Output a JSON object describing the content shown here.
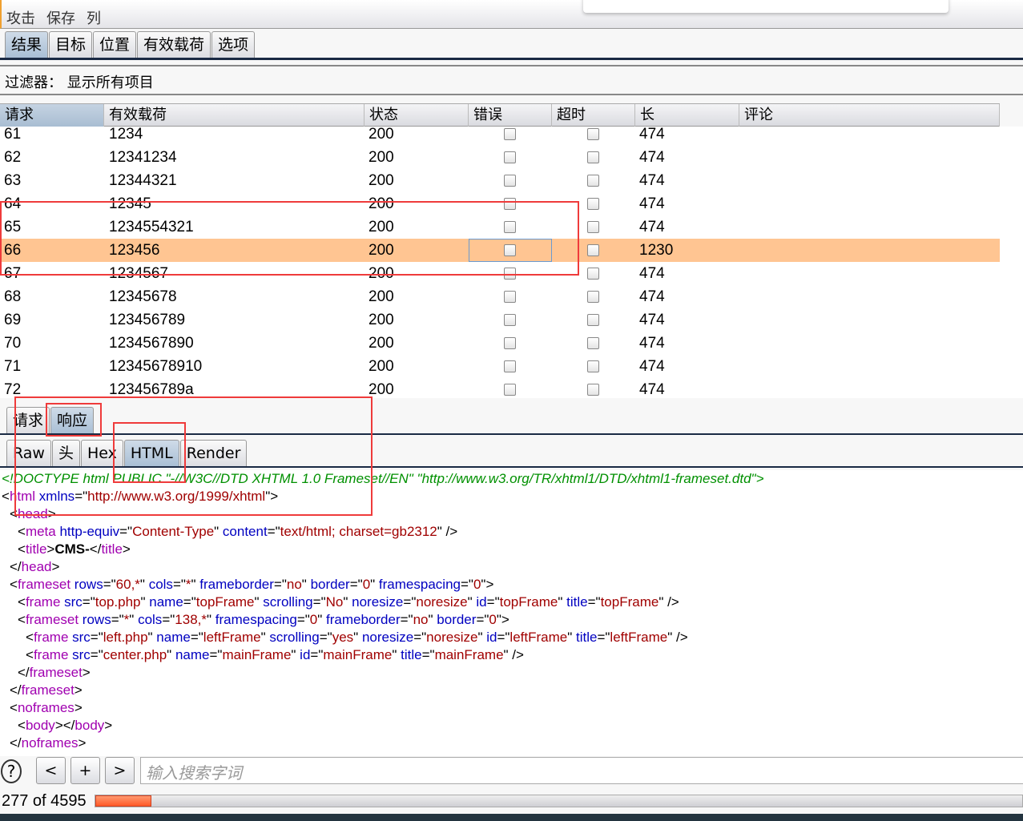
{
  "menu": [
    "攻击",
    "保存",
    "列"
  ],
  "main_tabs": [
    {
      "label": "结果",
      "selected": true
    },
    {
      "label": "目标"
    },
    {
      "label": "位置"
    },
    {
      "label": "有效载荷"
    },
    {
      "label": "选项"
    }
  ],
  "filter": "过滤器： 显示所有项目",
  "table": {
    "columns": [
      "请求",
      "有效载荷",
      "状态",
      "错误",
      "超时",
      "长",
      "评论"
    ],
    "sorted_column": "请求",
    "rows": [
      {
        "req": "61",
        "payload": "1234",
        "status": "200",
        "error": false,
        "timeout": false,
        "length": "474"
      },
      {
        "req": "62",
        "payload": "12341234",
        "status": "200",
        "error": false,
        "timeout": false,
        "length": "474"
      },
      {
        "req": "63",
        "payload": "12344321",
        "status": "200",
        "error": false,
        "timeout": false,
        "length": "474"
      },
      {
        "req": "64",
        "payload": "12345",
        "status": "200",
        "error": false,
        "timeout": false,
        "length": "474"
      },
      {
        "req": "65",
        "payload": "1234554321",
        "status": "200",
        "error": false,
        "timeout": false,
        "length": "474"
      },
      {
        "req": "66",
        "payload": "123456",
        "status": "200",
        "error": false,
        "timeout": false,
        "length": "1230",
        "selected": true
      },
      {
        "req": "67",
        "payload": "1234567",
        "status": "200",
        "error": false,
        "timeout": false,
        "length": "474"
      },
      {
        "req": "68",
        "payload": "12345678",
        "status": "200",
        "error": false,
        "timeout": false,
        "length": "474"
      },
      {
        "req": "69",
        "payload": "123456789",
        "status": "200",
        "error": false,
        "timeout": false,
        "length": "474"
      },
      {
        "req": "70",
        "payload": "1234567890",
        "status": "200",
        "error": false,
        "timeout": false,
        "length": "474"
      },
      {
        "req": "71",
        "payload": "12345678910",
        "status": "200",
        "error": false,
        "timeout": false,
        "length": "474"
      },
      {
        "req": "72",
        "payload": "123456789a",
        "status": "200",
        "error": false,
        "timeout": false,
        "length": "474"
      }
    ]
  },
  "detail_tabs": [
    {
      "label": "请求"
    },
    {
      "label": "响应",
      "selected": true
    }
  ],
  "view_tabs": [
    {
      "label": "Raw"
    },
    {
      "label": "头"
    },
    {
      "label": "Hex"
    },
    {
      "label": "HTML",
      "selected": true
    },
    {
      "label": "Render"
    }
  ],
  "code_lines": [
    {
      "indent": 0,
      "tokens": [
        [
          "doc",
          "<!DOCTYPE html PUBLIC \"-//W3C//DTD XHTML 1.0 Frameset//EN\" \"http://www.w3.org/TR/xhtml1/DTD/xhtml1-frameset.dtd\">"
        ]
      ]
    },
    {
      "indent": 0,
      "tokens": [
        [
          "punc",
          "<"
        ],
        [
          "tag",
          "html"
        ],
        [
          "attr",
          " xmlns"
        ],
        [
          "punc",
          "=\""
        ],
        [
          "val",
          "http://www.w3.org/1999/xhtml"
        ],
        [
          "punc",
          "\">"
        ]
      ]
    },
    {
      "indent": 1,
      "tokens": [
        [
          "punc",
          "<"
        ],
        [
          "tag",
          "head"
        ],
        [
          "punc",
          ">"
        ]
      ]
    },
    {
      "indent": 2,
      "tokens": [
        [
          "punc",
          "<"
        ],
        [
          "tag",
          "meta"
        ],
        [
          "attr",
          " http-equiv"
        ],
        [
          "punc",
          "=\""
        ],
        [
          "val",
          "Content-Type"
        ],
        [
          "punc",
          "\""
        ],
        [
          "attr",
          " content"
        ],
        [
          "punc",
          "=\""
        ],
        [
          "val",
          "text/html; charset=gb2312"
        ],
        [
          "punc",
          "\" />"
        ]
      ]
    },
    {
      "indent": 2,
      "tokens": [
        [
          "punc",
          "<"
        ],
        [
          "tag",
          "title"
        ],
        [
          "punc",
          ">"
        ],
        [
          "bold",
          "CMS-"
        ],
        [
          "punc",
          "</"
        ],
        [
          "tag",
          "title"
        ],
        [
          "punc",
          ">"
        ]
      ]
    },
    {
      "indent": 1,
      "tokens": [
        [
          "punc",
          "</"
        ],
        [
          "tag",
          "head"
        ],
        [
          "punc",
          ">"
        ]
      ]
    },
    {
      "indent": 1,
      "tokens": [
        [
          "punc",
          "<"
        ],
        [
          "tag",
          "frameset"
        ],
        [
          "attr",
          " rows"
        ],
        [
          "punc",
          "=\""
        ],
        [
          "val",
          "60,*"
        ],
        [
          "punc",
          "\""
        ],
        [
          "attr",
          " cols"
        ],
        [
          "punc",
          "=\""
        ],
        [
          "val",
          "*"
        ],
        [
          "punc",
          "\""
        ],
        [
          "attr",
          " frameborder"
        ],
        [
          "punc",
          "=\""
        ],
        [
          "val",
          "no"
        ],
        [
          "punc",
          "\""
        ],
        [
          "attr",
          " border"
        ],
        [
          "punc",
          "=\""
        ],
        [
          "val",
          "0"
        ],
        [
          "punc",
          "\""
        ],
        [
          "attr",
          " framespacing"
        ],
        [
          "punc",
          "=\""
        ],
        [
          "val",
          "0"
        ],
        [
          "punc",
          "\">"
        ]
      ]
    },
    {
      "indent": 2,
      "tokens": [
        [
          "punc",
          "<"
        ],
        [
          "tag",
          "frame"
        ],
        [
          "attr",
          " src"
        ],
        [
          "punc",
          "=\""
        ],
        [
          "val",
          "top.php"
        ],
        [
          "punc",
          "\""
        ],
        [
          "attr",
          " name"
        ],
        [
          "punc",
          "=\""
        ],
        [
          "val",
          "topFrame"
        ],
        [
          "punc",
          "\""
        ],
        [
          "attr",
          " scrolling"
        ],
        [
          "punc",
          "=\""
        ],
        [
          "val",
          "No"
        ],
        [
          "punc",
          "\""
        ],
        [
          "attr",
          " noresize"
        ],
        [
          "punc",
          "=\""
        ],
        [
          "val",
          "noresize"
        ],
        [
          "punc",
          "\""
        ],
        [
          "attr",
          " id"
        ],
        [
          "punc",
          "=\""
        ],
        [
          "val",
          "topFrame"
        ],
        [
          "punc",
          "\""
        ],
        [
          "attr",
          " title"
        ],
        [
          "punc",
          "=\""
        ],
        [
          "val",
          "topFrame"
        ],
        [
          "punc",
          "\" />"
        ]
      ]
    },
    {
      "indent": 2,
      "tokens": [
        [
          "punc",
          "<"
        ],
        [
          "tag",
          "frameset"
        ],
        [
          "attr",
          " rows"
        ],
        [
          "punc",
          "=\""
        ],
        [
          "val",
          "*"
        ],
        [
          "punc",
          "\""
        ],
        [
          "attr",
          " cols"
        ],
        [
          "punc",
          "=\""
        ],
        [
          "val",
          "138,*"
        ],
        [
          "punc",
          "\""
        ],
        [
          "attr",
          " framespacing"
        ],
        [
          "punc",
          "=\""
        ],
        [
          "val",
          "0"
        ],
        [
          "punc",
          "\""
        ],
        [
          "attr",
          " frameborder"
        ],
        [
          "punc",
          "=\""
        ],
        [
          "val",
          "no"
        ],
        [
          "punc",
          "\""
        ],
        [
          "attr",
          " border"
        ],
        [
          "punc",
          "=\""
        ],
        [
          "val",
          "0"
        ],
        [
          "punc",
          "\">"
        ]
      ]
    },
    {
      "indent": 3,
      "tokens": [
        [
          "punc",
          "<"
        ],
        [
          "tag",
          "frame"
        ],
        [
          "attr",
          " src"
        ],
        [
          "punc",
          "=\""
        ],
        [
          "val",
          "left.php"
        ],
        [
          "punc",
          "\""
        ],
        [
          "attr",
          " name"
        ],
        [
          "punc",
          "=\""
        ],
        [
          "val",
          "leftFrame"
        ],
        [
          "punc",
          "\""
        ],
        [
          "attr",
          " scrolling"
        ],
        [
          "punc",
          "=\""
        ],
        [
          "val",
          "yes"
        ],
        [
          "punc",
          "\""
        ],
        [
          "attr",
          " noresize"
        ],
        [
          "punc",
          "=\""
        ],
        [
          "val",
          "noresize"
        ],
        [
          "punc",
          "\""
        ],
        [
          "attr",
          " id"
        ],
        [
          "punc",
          "=\""
        ],
        [
          "val",
          "leftFrame"
        ],
        [
          "punc",
          "\""
        ],
        [
          "attr",
          " title"
        ],
        [
          "punc",
          "=\""
        ],
        [
          "val",
          "leftFrame"
        ],
        [
          "punc",
          "\" />"
        ]
      ]
    },
    {
      "indent": 3,
      "tokens": [
        [
          "punc",
          "<"
        ],
        [
          "tag",
          "frame"
        ],
        [
          "attr",
          " src"
        ],
        [
          "punc",
          "=\""
        ],
        [
          "val",
          "center.php"
        ],
        [
          "punc",
          "\""
        ],
        [
          "attr",
          " name"
        ],
        [
          "punc",
          "=\""
        ],
        [
          "val",
          "mainFrame"
        ],
        [
          "punc",
          "\""
        ],
        [
          "attr",
          " id"
        ],
        [
          "punc",
          "=\""
        ],
        [
          "val",
          "mainFrame"
        ],
        [
          "punc",
          "\""
        ],
        [
          "attr",
          " title"
        ],
        [
          "punc",
          "=\""
        ],
        [
          "val",
          "mainFrame"
        ],
        [
          "punc",
          "\" />"
        ]
      ]
    },
    {
      "indent": 2,
      "tokens": [
        [
          "punc",
          "</"
        ],
        [
          "tag",
          "frameset"
        ],
        [
          "punc",
          ">"
        ]
      ]
    },
    {
      "indent": 1,
      "tokens": [
        [
          "punc",
          "</"
        ],
        [
          "tag",
          "frameset"
        ],
        [
          "punc",
          ">"
        ]
      ]
    },
    {
      "indent": 1,
      "tokens": [
        [
          "punc",
          "<"
        ],
        [
          "tag",
          "noframes"
        ],
        [
          "punc",
          ">"
        ]
      ]
    },
    {
      "indent": 2,
      "tokens": [
        [
          "punc",
          "<"
        ],
        [
          "tag",
          "body"
        ],
        [
          "punc",
          "></"
        ],
        [
          "tag",
          "body"
        ],
        [
          "punc",
          ">"
        ]
      ]
    },
    {
      "indent": 1,
      "tokens": [
        [
          "punc",
          "</"
        ],
        [
          "tag",
          "noframes"
        ],
        [
          "punc",
          ">"
        ]
      ]
    }
  ],
  "search": {
    "help": "?",
    "prev": "<",
    "add": "+",
    "next": ">",
    "placeholder": "输入搜索字词"
  },
  "progress": {
    "label": "277 of 4595",
    "done": 277,
    "total": 4595
  },
  "colors": {
    "selected_row": "#ffc592",
    "annotation": "#ef3b3b",
    "progress": "#ff5a28"
  }
}
